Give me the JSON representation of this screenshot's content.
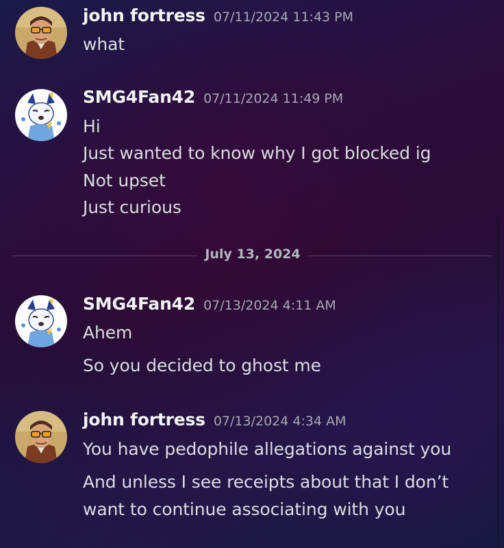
{
  "messages": [
    {
      "author": "john fortress",
      "avatar_icon": "man-with-sunglasses-avatar-icon",
      "timestamp": "07/11/2024 11:43 PM",
      "lines": [
        "what"
      ]
    },
    {
      "author": "SMG4Fan42",
      "avatar_icon": "cartoon-character-avatar-icon",
      "timestamp": "07/11/2024 11:49 PM",
      "lines": [
        "Hi",
        "Just wanted to know why I got blocked ig",
        "Not upset",
        "Just curious"
      ]
    },
    {
      "author": "SMG4Fan42",
      "avatar_icon": "cartoon-character-avatar-icon",
      "timestamp": "07/13/2024 4:11 AM",
      "lines": [
        "Ahem",
        "So you decided to ghost me"
      ]
    },
    {
      "author": "john fortress",
      "avatar_icon": "man-with-sunglasses-avatar-icon",
      "timestamp": "07/13/2024 4:34 AM",
      "lines": [
        "You have pedophile allegations against you",
        "And unless I see receipts about that I don’t",
        "want to continue associating with you"
      ]
    }
  ],
  "date_divider": "July 13, 2024",
  "colors": {
    "username": "#f2f3f5",
    "message_text": "#dcdde3",
    "timestamp": "#a8a9b5"
  }
}
